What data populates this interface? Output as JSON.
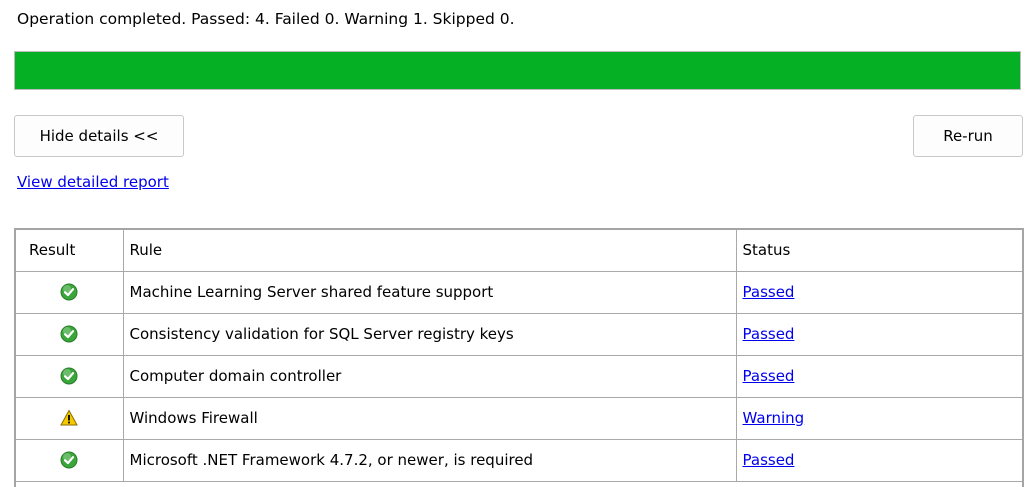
{
  "summary_text": "Operation completed. Passed: 4.   Failed 0.   Warning 1.   Skipped 0.",
  "progress": {
    "fraction": 1.0,
    "color": "#06b025"
  },
  "buttons": {
    "hide_details": "Hide details <<",
    "rerun": "Re-run"
  },
  "report_link": "View detailed report",
  "table": {
    "headers": {
      "result": "Result",
      "rule": "Rule",
      "status": "Status"
    },
    "rows": [
      {
        "icon": "passed-check-icon",
        "rule": "Machine Learning Server shared feature support",
        "status": "Passed"
      },
      {
        "icon": "passed-check-icon",
        "rule": "Consistency validation for SQL Server registry keys",
        "status": "Passed"
      },
      {
        "icon": "passed-check-icon",
        "rule": "Computer domain controller",
        "status": "Passed"
      },
      {
        "icon": "warning-triangle-icon",
        "rule": "Windows Firewall",
        "status": "Warning"
      },
      {
        "icon": "passed-check-icon",
        "rule": "Microsoft .NET Framework 4.7.2, or newer, is required",
        "status": "Passed"
      }
    ]
  },
  "colors": {
    "link": "#0000ee",
    "passed_icon": "#3aa63a",
    "warning_icon": "#f5c800"
  }
}
